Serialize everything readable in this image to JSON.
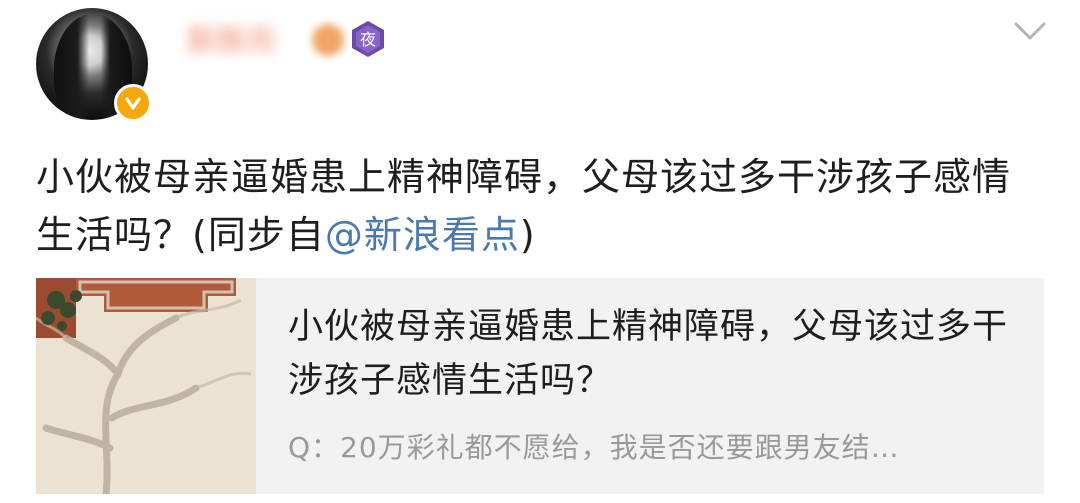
{
  "post": {
    "author": {
      "name": "飘飘雨",
      "verified_badge": "V",
      "night_badge": "夜"
    },
    "text_main": "小伙被母亲逼婚患上精神障碍，父母该过多干涉孩子感情生活吗？(同步自",
    "mention": "@新浪看点",
    "text_close": ")"
  },
  "card": {
    "title": "小伙被母亲逼婚患上精神障碍，父母该过多干涉孩子感情生活吗？",
    "desc": "Q：20万彩礼都不愿给，我是否还要跟男友结…"
  },
  "colors": {
    "mention": "#4b78ad",
    "badge": "#f5a70c",
    "night_badge": "#6e4aa8",
    "card_bg": "#f2f2f2",
    "desc": "#999999"
  },
  "icons": {
    "menu": "chevron-down-icon",
    "verified": "verified-badge-icon",
    "night": "night-mode-badge-icon"
  }
}
